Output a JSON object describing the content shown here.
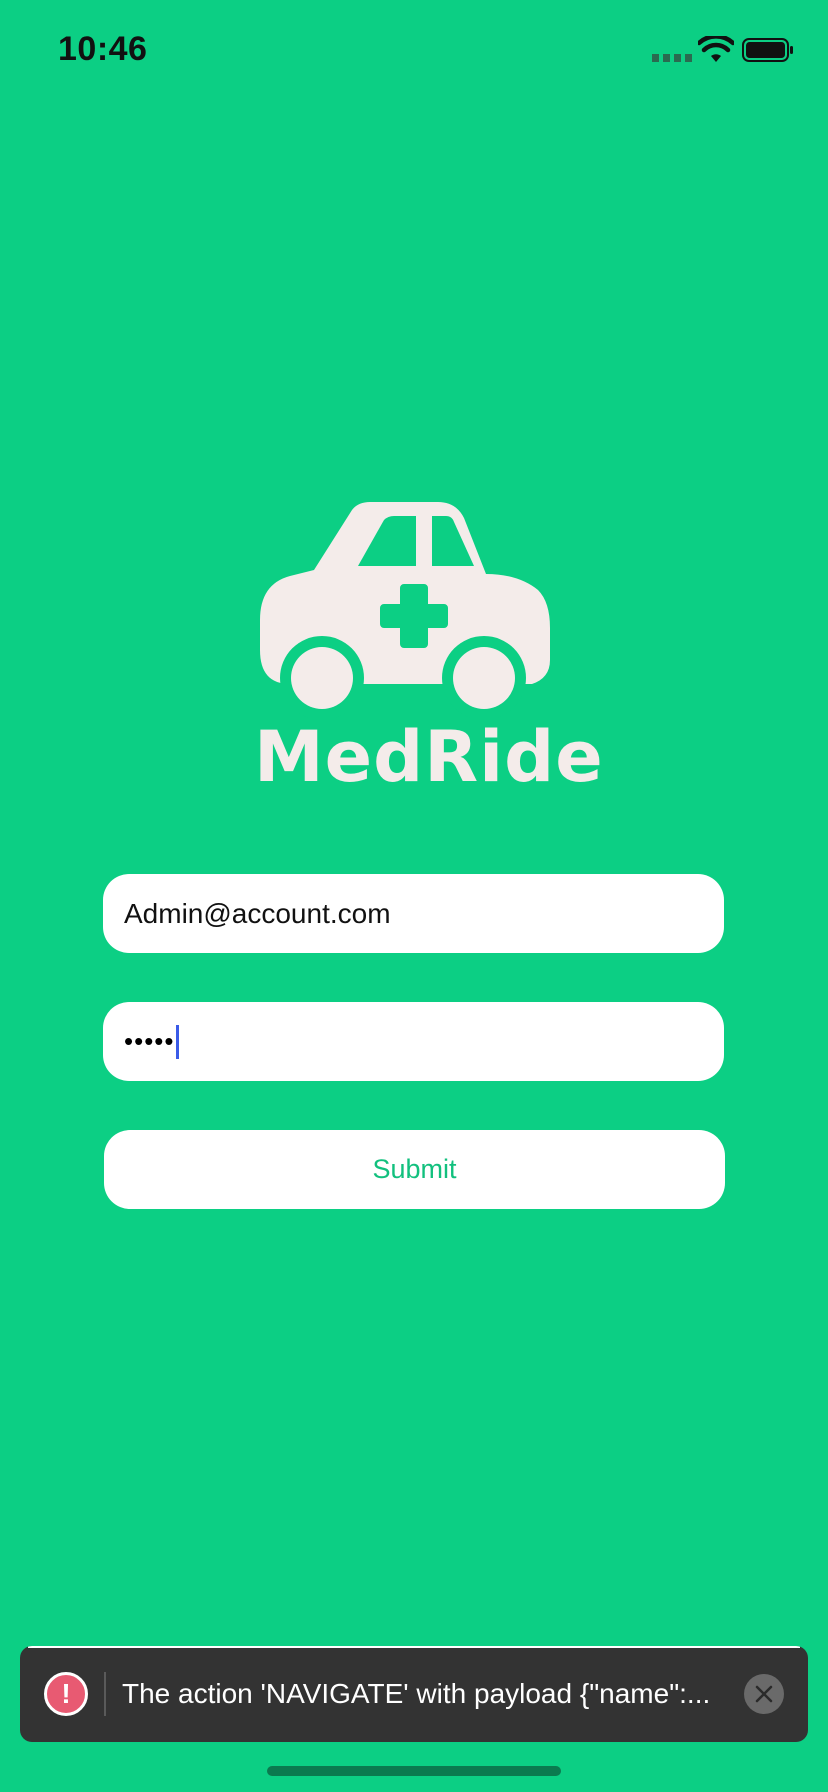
{
  "status_bar": {
    "time": "10:46"
  },
  "logo": {
    "text": "MedRide"
  },
  "login_form": {
    "email_value": "Admin@account.com",
    "password_masked": "•••••",
    "submit_label": "Submit"
  },
  "toast": {
    "message": "The action 'NAVIGATE' with payload {\"name\":..."
  },
  "colors": {
    "background": "#0CCF84",
    "accent": "#12C07E",
    "logo_fill": "#F4ECEA",
    "toast_background": "#333333",
    "error": "#E85A72"
  }
}
